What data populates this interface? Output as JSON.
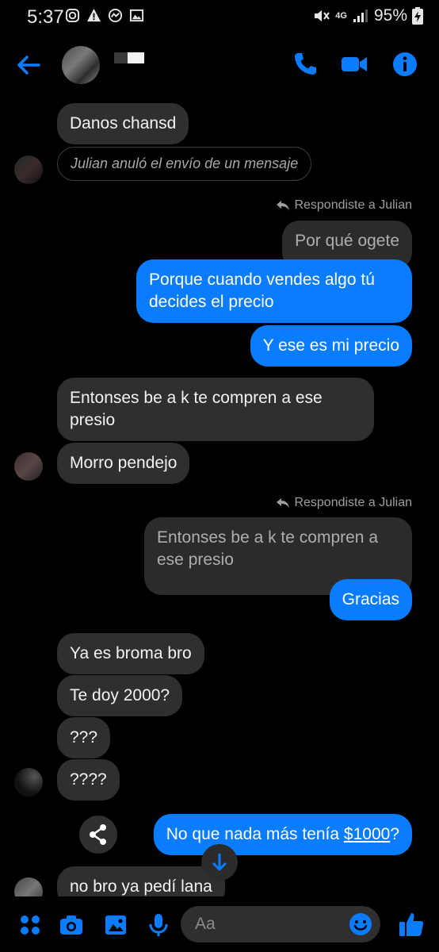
{
  "status": {
    "time": "5:37",
    "network": "4G",
    "battery": "95%"
  },
  "header": {
    "back": "back",
    "call": "call",
    "video": "video",
    "info": "info"
  },
  "messages": {
    "m1": "Danos chansd",
    "unsent": "Julian anuló el envío de un mensaje",
    "reply_note": "Respondiste a Julian",
    "quote1": "Por qué ogete",
    "m2": "Porque cuando vendes algo tú decides el precio",
    "m3": "Y ese es mi precio",
    "m4": "Entonses be a k te compren a ese presio",
    "m5": "Morro pendejo",
    "quote2": "Entonses be a k te compren a ese presio",
    "m6": "Gracias",
    "m7": "Ya es broma bro",
    "m8": "Te doy 2000?",
    "m9": "???",
    "m10": "????",
    "m11_text": "No que nada más tenía ",
    "m11_link": "$1000",
    "m11_end": "?",
    "m12": "no bro ya pedí lana"
  },
  "composer": {
    "placeholder": "Aa"
  },
  "colors": {
    "accent": "#0a7cff",
    "incoming": "#2f2f2f",
    "background": "#000000"
  }
}
